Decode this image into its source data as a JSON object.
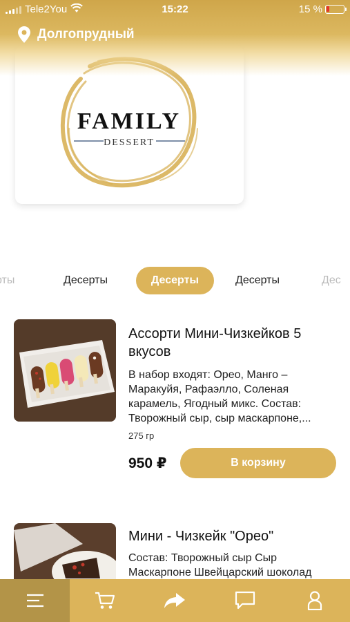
{
  "status_bar": {
    "carrier": "Tele2You",
    "time": "15:22",
    "battery": "15 %",
    "battery_level": 0.15
  },
  "location": {
    "city": "Долгопрудный",
    "icon": "location-pin-icon"
  },
  "logo": {
    "brand": "FAMILY",
    "subtitle": "DESSERT"
  },
  "categories": [
    {
      "label": "рты",
      "state": "faded"
    },
    {
      "label": "Десерты",
      "state": "normal"
    },
    {
      "label": "Десерты",
      "state": "active"
    },
    {
      "label": "Десерты",
      "state": "normal"
    },
    {
      "label": "Дес",
      "state": "faded"
    }
  ],
  "products": [
    {
      "title": "Ассорти Мини-Чизкейков 5 вкусов",
      "description": "В набор входят: Орео, Манго – Маракуйя, Рафаэлло, Соленая карамель, Ягодный микс. Состав: Творожный сыр, сыр маскарпоне,...",
      "weight": "275 гр",
      "price": "950 ₽",
      "button": "В корзину"
    },
    {
      "title": "Мини - Чизкейк \"Орео\"",
      "description": "Состав: Творожный сыр Сыр Маскарпоне Швейцарский шоколад"
    }
  ],
  "bottom_nav": [
    {
      "name": "menu",
      "icon": "menu-icon",
      "active": true
    },
    {
      "name": "cart",
      "icon": "cart-icon",
      "active": false
    },
    {
      "name": "share",
      "icon": "share-arrow-icon",
      "active": false
    },
    {
      "name": "chat",
      "icon": "chat-icon",
      "active": false
    },
    {
      "name": "profile",
      "icon": "profile-icon",
      "active": false
    }
  ],
  "colors": {
    "accent": "#dcb45a",
    "accent_dark": "#b39448",
    "text": "#111111"
  }
}
